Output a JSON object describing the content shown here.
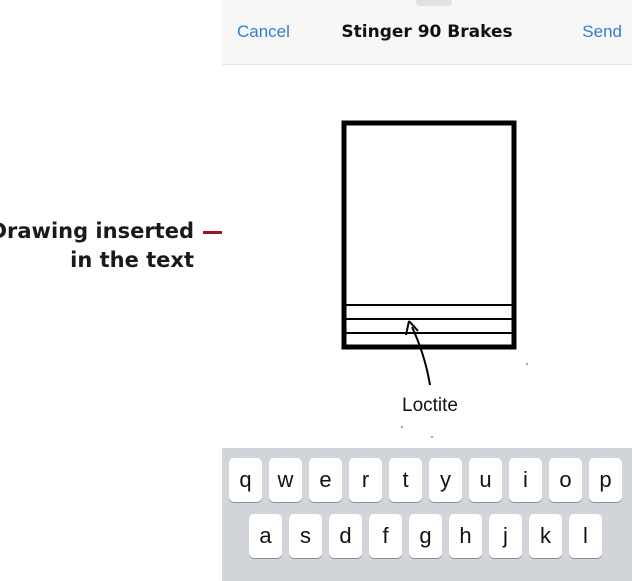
{
  "annotation": {
    "text_line1": "Drawing inserted",
    "text_line2": "in the text",
    "accent": "#a0141e"
  },
  "navbar": {
    "cancel": "Cancel",
    "title": "Stinger 90 Brakes",
    "send": "Send",
    "link_color": "#2f7fd0"
  },
  "drawing": {
    "label": "Loctite"
  },
  "keyboard": {
    "row1": [
      "q",
      "w",
      "e",
      "r",
      "t",
      "y",
      "u",
      "i",
      "o",
      "p"
    ],
    "row2": [
      "a",
      "s",
      "d",
      "f",
      "g",
      "h",
      "j",
      "k",
      "l"
    ]
  }
}
